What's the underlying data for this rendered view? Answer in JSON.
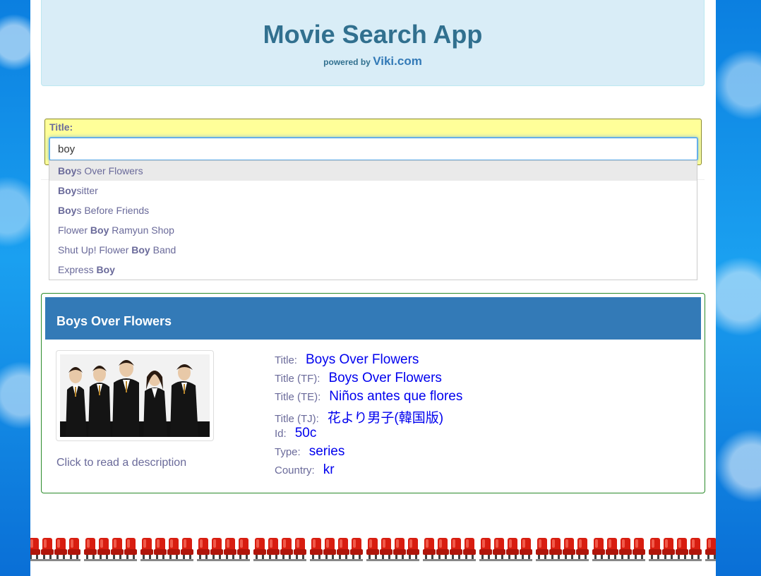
{
  "header": {
    "title": "Movie Search App",
    "powered_by": "powered by",
    "brand": "Viki.com"
  },
  "search": {
    "label": "Title:",
    "value": "boy"
  },
  "suggestions": [
    {
      "bold": "Boy",
      "pre": "",
      "post": "s Over Flowers"
    },
    {
      "bold": "Boy",
      "pre": "",
      "post": "sitter"
    },
    {
      "bold": "Boy",
      "pre": "",
      "post": "s Before Friends"
    },
    {
      "bold": "Boy",
      "pre": "Flower ",
      "post": " Ramyun Shop"
    },
    {
      "bold": "Boy",
      "pre": "Shut Up! Flower ",
      "post": " Band"
    },
    {
      "bold": "Boy",
      "pre": "Express ",
      "post": ""
    }
  ],
  "result": {
    "heading": "Boys Over Flowers",
    "description_link": "Click to read a description",
    "fields": [
      {
        "key": "Title:",
        "value": "Boys Over Flowers"
      },
      {
        "key": "Title (TF):",
        "value": "Boys Over Flowers"
      },
      {
        "key": "Title (TE):",
        "value": "Niños antes que flores"
      },
      {
        "key": "Title (TJ):",
        "value": "花より男子(韓国版)"
      },
      {
        "key": "Id:",
        "value": "50c"
      },
      {
        "key": "Type:",
        "value": "series"
      },
      {
        "key": "Country:",
        "value": "kr"
      }
    ]
  },
  "colors": {
    "accent": "#337ab7",
    "jumbotron_bg": "#d9edf7",
    "search_bg": "#ffff99",
    "link_value": "#0000ee"
  }
}
